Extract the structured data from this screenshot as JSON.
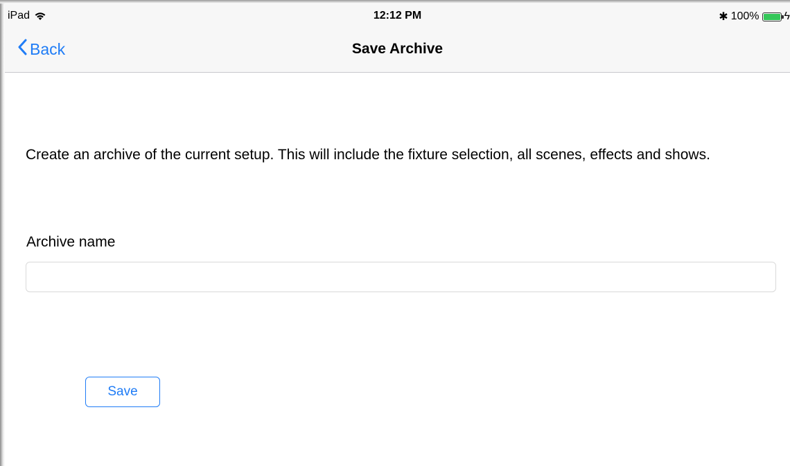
{
  "status_bar": {
    "device": "iPad",
    "time": "12:12 PM",
    "bluetooth": "✱",
    "battery_percent_label": "100%",
    "battery_level": 1.0,
    "battery_color": "#34c759",
    "charging": "ϟ"
  },
  "nav": {
    "back_label": "Back",
    "title": "Save Archive",
    "accent_color": "#1f7cf6"
  },
  "content": {
    "description": "Create an archive of the current setup. This will include the fixture selection, all scenes, effects and shows.",
    "field_label": "Archive name",
    "field_value": "",
    "field_placeholder": "",
    "save_label": "Save"
  },
  "icons": {
    "wifi": "wifi-icon",
    "back": "chevron-left-icon",
    "bluetooth": "bluetooth-icon",
    "battery": "battery-icon",
    "charging": "charging-bolt-icon"
  }
}
